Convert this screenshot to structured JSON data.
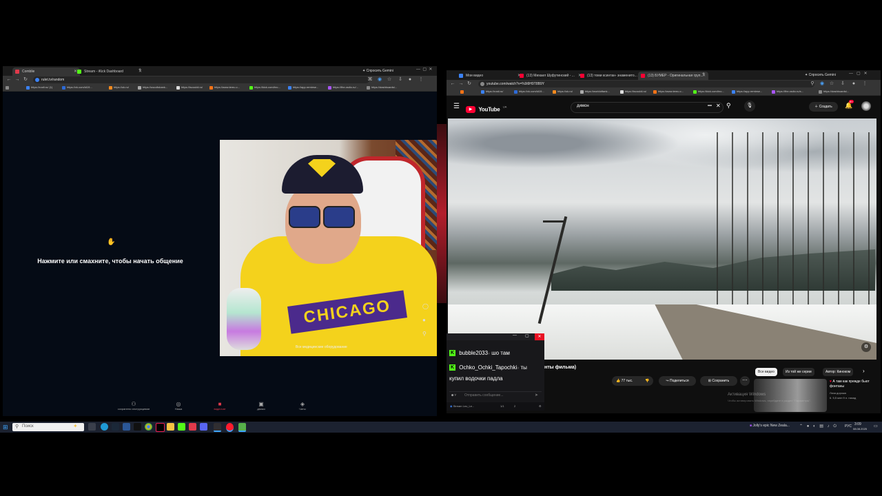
{
  "left_browser": {
    "tabs": [
      {
        "label": "Comblie",
        "color": "#e03a4b"
      },
      {
        "label": "Stream - iKick Dashboard",
        "color": "#53fc18"
      }
    ],
    "gemini_label": "Спросить Gemini",
    "url": "rulet.tv/random",
    "bookmarks": [
      "https://rosfi.ru/ (1)",
      "https://vk.com/id19...",
      "https://ok.ru/",
      "https://uscollsbank...",
      "https://iscouldi.ru/",
      "https://www.temu.c...",
      "https://kick.com/bro...",
      "https://app.remiese...",
      "https://fhe-radio.ru/...",
      "https://dashboards/..."
    ],
    "prompt_text": "Нажмите или смахните, чтобы начать общение",
    "bottom_nav": [
      {
        "label": "сохранено инструкциями",
        "icon": "user-add-icon"
      },
      {
        "label": "Наша",
        "icon": "chat-icon"
      },
      {
        "label": "видеочат",
        "icon": "video-icon"
      },
      {
        "label": "движо",
        "icon": "grid-icon"
      },
      {
        "label": "Чаты",
        "icon": "message-icon"
      }
    ],
    "cam_overlay": "Все   медицинские оборудование"
  },
  "right_browser": {
    "tabs": [
      {
        "label": "Мои видео",
        "color": "#3b82f6"
      },
      {
        "label": "(13) Михаил Шуфутинский - ...",
        "color": "#ff0033"
      },
      {
        "label": "(13) томи ксинтан- знаменито...",
        "color": "#ff0033"
      },
      {
        "label": "(13) БУМЕР - Оригинальная груп...",
        "color": "#ff0033"
      }
    ],
    "gemini_label": "Спросить Gemini",
    "url": "youtube.com/watch?v=%9i9H9T8B9Y",
    "bookmarks": [
      "https://rosti.ru/",
      "https://vk.com/id19...",
      "https://ok.ru/",
      "https://worldoftank...",
      "https://iscouldi.ru/",
      "https://www.temu.c...",
      "https://kick.com/bro...",
      "https://app.remiese...",
      "https://fhe-radio.ru/s...",
      "https://dashboards/..."
    ]
  },
  "youtube": {
    "logo": "YouTube",
    "logo_sup": "UA",
    "search_value": "димон",
    "create_label": "Создать",
    "notif_badge": "9+",
    "video_title_fragment": "нты фильма)",
    "likes": "77 тыс.",
    "share": "Поделиться",
    "save": "Сохранить",
    "chips": [
      "Все видео",
      "Из той же серии",
      "Автор: Киноком"
    ],
    "rec_title": "А там как прежде бьют фонтаны",
    "rec_channel": "Лиза дорожа",
    "rec_meta": "6. 5,5 млн   9 л. назад",
    "activation_title": "Активация Windows",
    "activation_sub": "Чтобы активировать Windows, перейдите в раздел \"Параметры\"."
  },
  "kick_chat": {
    "messages": [
      {
        "user": "bubble2033",
        "text": "шо там"
      },
      {
        "user": "Ochko_Ochki_Tapochki",
        "text": "ты"
      },
      {
        "user": "",
        "text": "купил водочки падла"
      }
    ],
    "input_placeholder": "Отправить сообщение...",
    "footer_label": "Stream Leo_Le...",
    "footer_count": "1/1",
    "footer_count2": "2"
  },
  "taskbar": {
    "search_placeholder": "Поиск",
    "notif_text": "Jolly's epic New Zeala...",
    "lang": "РУС",
    "time": "3:09",
    "date": "08.08.2025"
  },
  "colors": {
    "kick_green": "#53fc18",
    "youtube_red": "#ff0033",
    "shirt_yellow": "#f4d21c"
  }
}
